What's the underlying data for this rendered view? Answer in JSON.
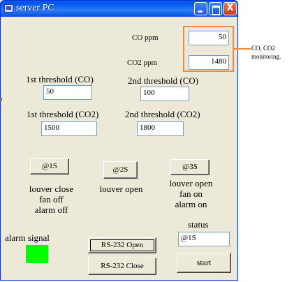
{
  "window": {
    "title": "server PC",
    "minimize_label": "",
    "maximize_label": "",
    "close_label": "X"
  },
  "co": {
    "label": "CO ppm",
    "value": "50"
  },
  "co2": {
    "label": "CO2 ppm",
    "value": "1480"
  },
  "thresholds": {
    "co_first": {
      "label": "1st threshold (CO)",
      "value": "50"
    },
    "co_second": {
      "label": "2nd threshold (CO)",
      "value": "100"
    },
    "co2_first": {
      "label": "1st threshold (CO2)",
      "value": "1500"
    },
    "co2_second": {
      "label": "2nd threshold (CO2)",
      "value": "1800"
    }
  },
  "states": [
    {
      "button": "@1S",
      "line1": "louver close",
      "line2": "fan off",
      "line3": "alarm off"
    },
    {
      "button": "@2S",
      "line1": "louver open",
      "line2": "",
      "line3": ""
    },
    {
      "button": "@3S",
      "line1": "louver open",
      "line2": "fan on",
      "line3": "alarm on"
    }
  ],
  "alarm": {
    "label": "alarm signal",
    "color": "#00ff00"
  },
  "status": {
    "label": "status",
    "value": "@1S"
  },
  "buttons": {
    "rs232_open": "RS-232 Open",
    "rs232_close": "RS-232 Close",
    "start": "start"
  },
  "annotation": {
    "line1": "CO, CO2",
    "line2": "monitoring.",
    "color": "#f08a3c"
  }
}
